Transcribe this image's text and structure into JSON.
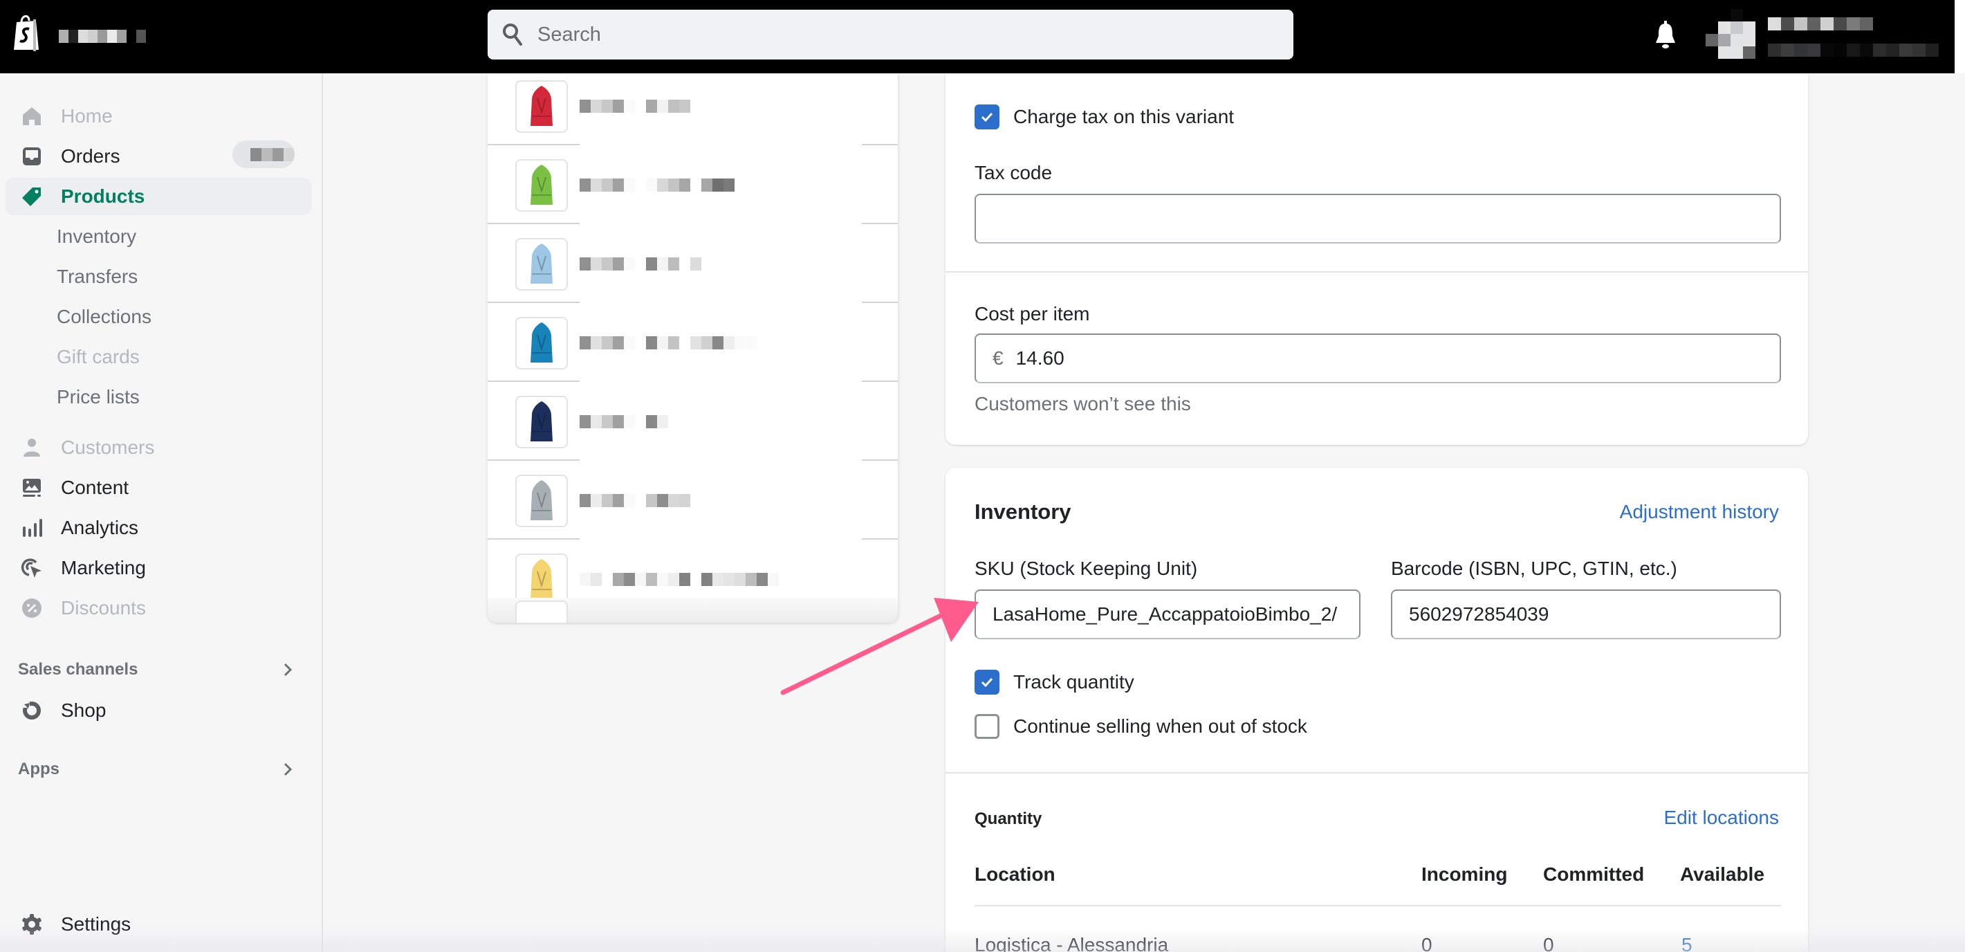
{
  "topbar": {
    "search_placeholder": "Search",
    "store_name": "[blurred]",
    "user_name": "[blurred]",
    "icons": {
      "logo": "shopify-bag-icon",
      "search": "search-icon",
      "notifications": "bell-icon"
    }
  },
  "sidebar": {
    "items": [
      {
        "label": "Home",
        "icon": "home-icon",
        "state": "disabled"
      },
      {
        "label": "Orders",
        "icon": "orders-inbox-icon",
        "state": "normal",
        "badge": "[blurred]"
      },
      {
        "label": "Products",
        "icon": "tag-icon",
        "state": "active"
      },
      {
        "label": "Customers",
        "icon": "person-icon",
        "state": "disabled"
      },
      {
        "label": "Content",
        "icon": "image-icon",
        "state": "normal"
      },
      {
        "label": "Analytics",
        "icon": "bar-chart-icon",
        "state": "normal"
      },
      {
        "label": "Marketing",
        "icon": "target-cursor-icon",
        "state": "normal"
      },
      {
        "label": "Discounts",
        "icon": "discount-badge-icon",
        "state": "disabled"
      }
    ],
    "products_sub": [
      {
        "label": "Inventory",
        "state": "normal"
      },
      {
        "label": "Transfers",
        "state": "normal"
      },
      {
        "label": "Collections",
        "state": "normal"
      },
      {
        "label": "Gift cards",
        "state": "disabled"
      },
      {
        "label": "Price lists",
        "state": "normal"
      }
    ],
    "sales_channels": {
      "label": "Sales channels",
      "items": [
        {
          "label": "Shop",
          "icon": "shop-icon"
        }
      ]
    },
    "apps": {
      "label": "Apps"
    },
    "settings": {
      "label": "Settings",
      "icon": "gear-icon"
    }
  },
  "variants": {
    "rows": [
      {
        "color_name": "red",
        "color": "#d3283a",
        "name": "[blurred]"
      },
      {
        "color_name": "green",
        "color": "#7ac143",
        "name": "[blurred]"
      },
      {
        "color_name": "light blue",
        "color": "#9dc7e4",
        "name": "[blurred]"
      },
      {
        "color_name": "teal blue",
        "color": "#1883b8",
        "name": "[blurred]"
      },
      {
        "color_name": "navy",
        "color": "#1c2f5c",
        "name": "[blurred]"
      },
      {
        "color_name": "grey",
        "color": "#a8b0b5",
        "name": "[blurred]"
      },
      {
        "color_name": "yellow",
        "color": "#f3d46e",
        "name": "[blurred]"
      }
    ]
  },
  "tax": {
    "charge_tax_label": "Charge tax on this variant",
    "charge_tax_checked": true,
    "tax_code_label": "Tax code",
    "tax_code_value": ""
  },
  "cost": {
    "label": "Cost per item",
    "currency_symbol": "€",
    "value": "14.60",
    "help": "Customers won’t see this"
  },
  "inventory": {
    "title": "Inventory",
    "adjustment_history_link": "Adjustment history",
    "sku_label": "SKU (Stock Keeping Unit)",
    "sku_value": "LasaHome_Pure_AccappatoioBimbo_2/",
    "barcode_label": "Barcode (ISBN, UPC, GTIN, etc.)",
    "barcode_value": "5602972854039",
    "track_quantity_label": "Track quantity",
    "track_quantity_checked": true,
    "continue_selling_label": "Continue selling when out of stock",
    "continue_selling_checked": false,
    "quantity_title": "Quantity",
    "edit_locations_link": "Edit locations",
    "columns": [
      "Location",
      "Incoming",
      "Committed",
      "Available"
    ],
    "rows": [
      {
        "location": "Logistica - Alessandria",
        "incoming": "0",
        "committed": "0",
        "available": "5"
      }
    ]
  },
  "annotation": {
    "type": "arrow",
    "color": "#ff5c8d",
    "points_to": "sku-field"
  },
  "colors": {
    "accent_green": "#008060",
    "link_blue": "#2c6ecb",
    "checkbox_blue": "#2c6ecb"
  }
}
